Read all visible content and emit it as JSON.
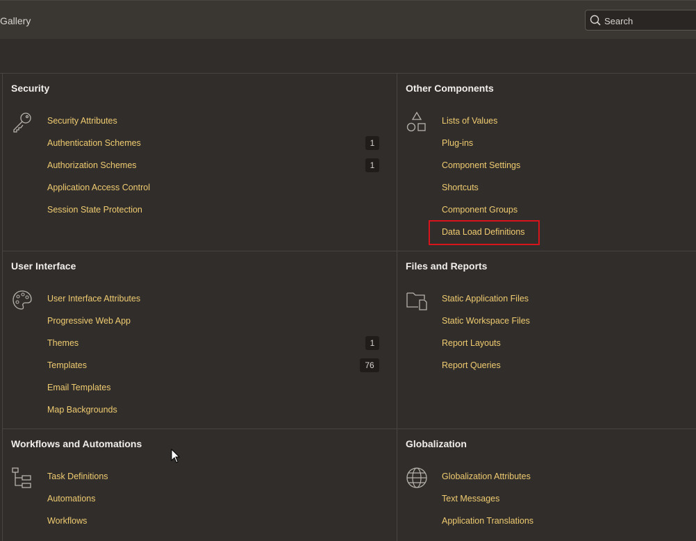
{
  "header": {
    "breadcrumb": "Gallery",
    "search_placeholder": "Search"
  },
  "sections": {
    "security": {
      "title": "Security",
      "icon": "key-icon",
      "items": [
        {
          "label": "Security Attributes",
          "badge": ""
        },
        {
          "label": "Authentication Schemes",
          "badge": "1"
        },
        {
          "label": "Authorization Schemes",
          "badge": "1"
        },
        {
          "label": "Application Access Control",
          "badge": ""
        },
        {
          "label": "Session State Protection",
          "badge": ""
        }
      ]
    },
    "other_components": {
      "title": "Other Components",
      "icon": "shapes-icon",
      "items": [
        {
          "label": "Lists of Values"
        },
        {
          "label": "Plug-ins"
        },
        {
          "label": "Component Settings"
        },
        {
          "label": "Shortcuts"
        },
        {
          "label": "Component Groups"
        },
        {
          "label": "Data Load Definitions"
        }
      ]
    },
    "user_interface": {
      "title": "User Interface",
      "icon": "palette-icon",
      "items": [
        {
          "label": "User Interface Attributes",
          "badge": ""
        },
        {
          "label": "Progressive Web App",
          "badge": ""
        },
        {
          "label": "Themes",
          "badge": "1"
        },
        {
          "label": "Templates",
          "badge": "76"
        },
        {
          "label": "Email Templates",
          "badge": ""
        },
        {
          "label": "Map Backgrounds",
          "badge": ""
        }
      ]
    },
    "files_reports": {
      "title": "Files and Reports",
      "icon": "folder-icon",
      "items": [
        {
          "label": "Static Application Files"
        },
        {
          "label": "Static Workspace Files"
        },
        {
          "label": "Report Layouts"
        },
        {
          "label": "Report Queries"
        }
      ]
    },
    "workflows": {
      "title": "Workflows and Automations",
      "icon": "tree-icon",
      "items": [
        {
          "label": "Task Definitions"
        },
        {
          "label": "Automations"
        },
        {
          "label": "Workflows"
        }
      ]
    },
    "globalization": {
      "title": "Globalization",
      "icon": "globe-icon",
      "items": [
        {
          "label": "Globalization Attributes"
        },
        {
          "label": "Text Messages"
        },
        {
          "label": "Application Translations"
        }
      ]
    }
  },
  "colors": {
    "background": "#312d2a",
    "link": "#f0cc71",
    "highlight": "#d9131c"
  }
}
